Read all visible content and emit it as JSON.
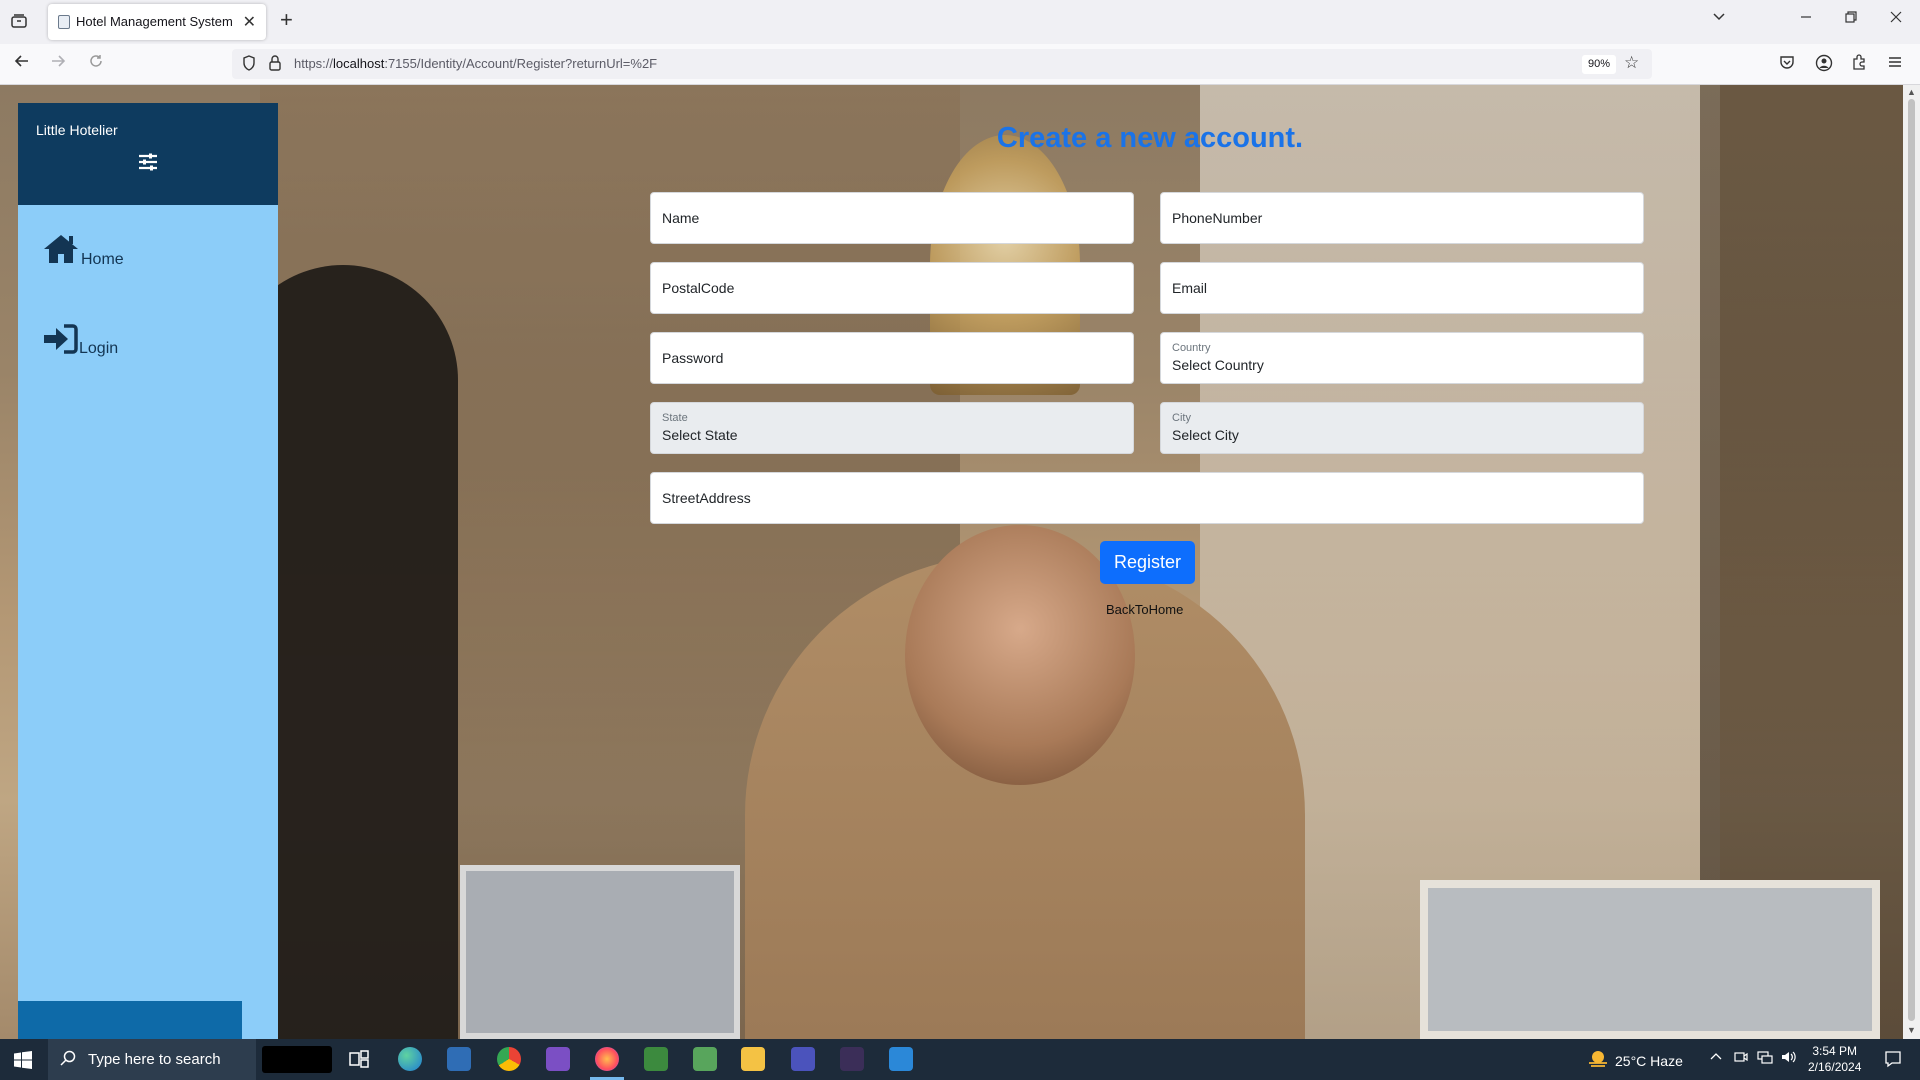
{
  "browser": {
    "tab_title": "Hotel Management System",
    "url_prefix": "https://",
    "url_host": "localhost",
    "url_rest": ":7155/Identity/Account/Register?returnUrl=%2F",
    "zoom": "90%"
  },
  "sidebar": {
    "brand": "Little Hotelier",
    "items": [
      {
        "label": "Home",
        "icon": "home-icon"
      },
      {
        "label": "Login",
        "icon": "login-icon"
      }
    ]
  },
  "form": {
    "title": "Create a new account.",
    "name_placeholder": "Name",
    "phone_placeholder": "PhoneNumber",
    "postal_placeholder": "PostalCode",
    "email_placeholder": "Email",
    "password_placeholder": "Password",
    "country_label": "Country",
    "country_value": "Select Country",
    "state_label": "State",
    "state_value": "Select State",
    "city_label": "City",
    "city_value": "Select City",
    "street_placeholder": "StreetAddress",
    "register_label": "Register",
    "back_link": "BackToHome"
  },
  "taskbar": {
    "search_placeholder": "Type here to search",
    "weather": "25°C  Haze",
    "time": "3:54 PM",
    "date": "2/16/2024"
  },
  "colors": {
    "sidebar_dark": "#0e3b5f",
    "sidebar_light": "#8ccdf9",
    "accent": "#0d6efd",
    "title_blue": "#1a73e8"
  }
}
